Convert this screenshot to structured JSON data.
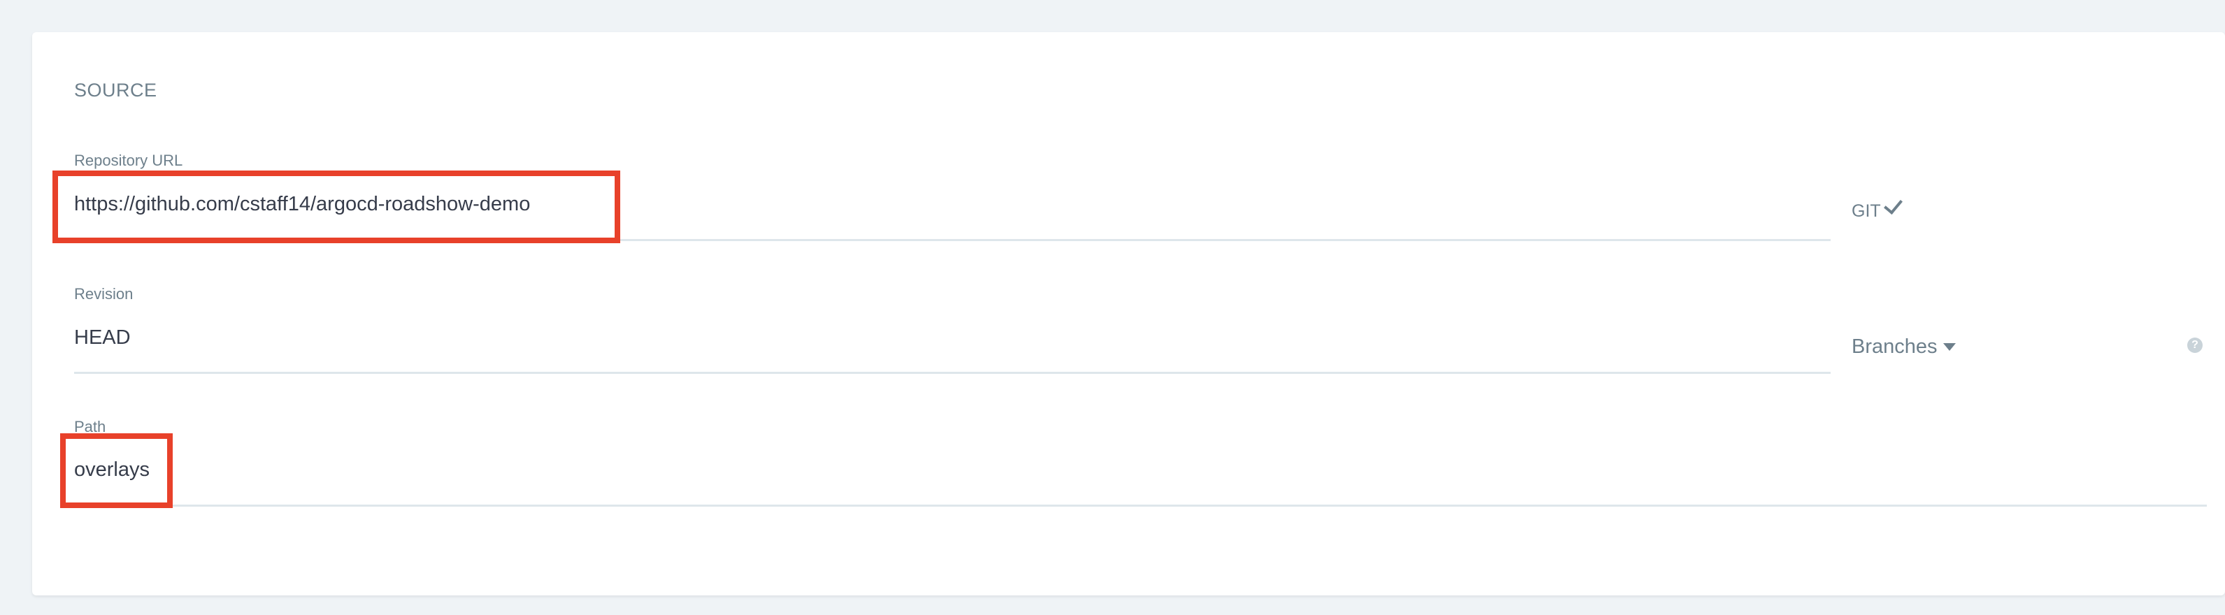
{
  "source": {
    "title": "SOURCE",
    "repository": {
      "label": "Repository URL",
      "value": "https://github.com/cstaff14/argocd-roadshow-demo",
      "type_label": "GIT"
    },
    "revision": {
      "label": "Revision",
      "value": "HEAD",
      "dropdown_label": "Branches"
    },
    "path": {
      "label": "Path",
      "value": "overlays"
    }
  },
  "icons": {
    "git_check": "check-icon",
    "branches_caret": "caret-down-icon",
    "help": "question-circle-icon"
  },
  "colors": {
    "highlight": "#e8412a",
    "label": "#6d7f8b",
    "text": "#363c4a",
    "background": "#eff3f6"
  }
}
